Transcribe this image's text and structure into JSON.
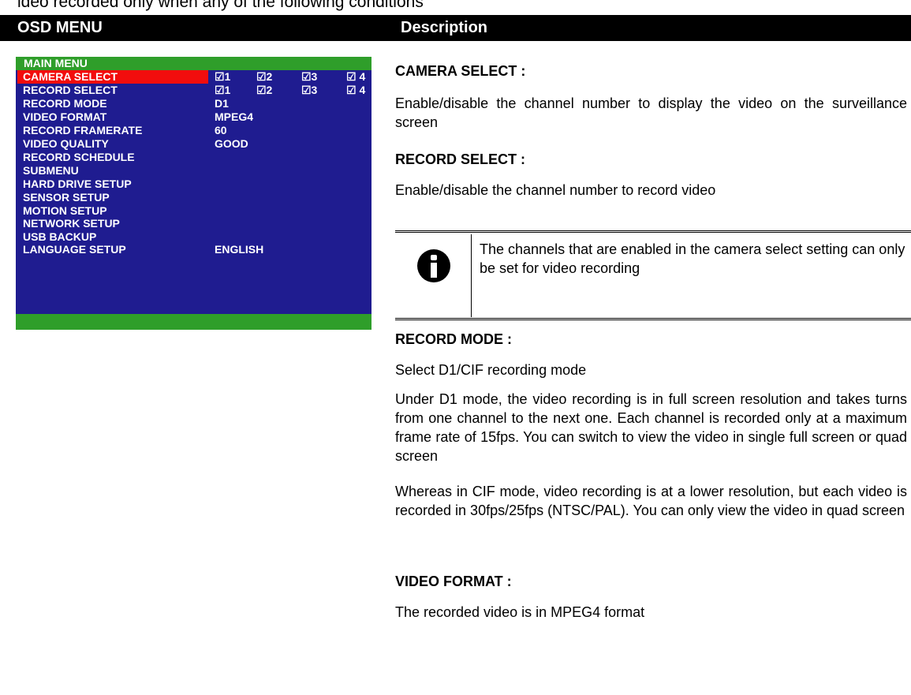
{
  "clipped_line": "ideo recorded only when any of the following conditions",
  "header": {
    "osd_menu": "OSD MENU",
    "description": "Description"
  },
  "osd": {
    "title": "MAIN  MENU",
    "rows": [
      {
        "label": "CAMERA  SELECT",
        "checks": [
          "☑1",
          "☑2",
          "☑3",
          "☑ 4"
        ],
        "selected": true
      },
      {
        "label": "RECORD  SELECT",
        "checks": [
          "☑1",
          "☑2",
          "☑3",
          "☑ 4"
        ]
      },
      {
        "label": "RECORD  MODE",
        "value": "D1"
      },
      {
        "label": "VIDEO  FORMAT",
        "value": "MPEG4"
      },
      {
        "label": "RECORD  FRAMERATE",
        "value": "60"
      },
      {
        "label": "VIDEO  QUALITY",
        "value": "GOOD"
      },
      {
        "label": "RECORD SCHEDULE",
        "value": ""
      },
      {
        "label": "SUBMENU",
        "value": ""
      },
      {
        "label": "HARD  DRIVE  SETUP",
        "value": ""
      },
      {
        "label": "SENSOR  SETUP",
        "value": ""
      },
      {
        "label": "MOTION  SETUP",
        "value": ""
      },
      {
        "label": "NETWORK SETUP",
        "value": ""
      },
      {
        "label": "USB BACKUP",
        "value": ""
      },
      {
        "label": "LANGUAGE  SETUP",
        "value": "ENGLISH"
      }
    ],
    "colors": {
      "panel": "#1f1c90",
      "bar": "#2f9e2a",
      "highlight": "#f20d0d"
    }
  },
  "description": {
    "camera_select_head": "CAMERA   SELECT :",
    "camera_select_text": "Enable/disable the channel number to display the video on the surveillance screen",
    "record_select_head": "RECORD   SELECT :",
    "record_select_text": "Enable/disable the channel number to record video",
    "note_text": "The channels that are enabled in the camera select setting can only be set for video recording",
    "record_mode_head": "RECORD   MODE :",
    "record_mode_text1": "Select D1/CIF recording mode",
    "record_mode_text2": "Under D1 mode, the video recording is in full screen resolution and takes turns from one channel to the next one. Each channel is recorded only at a maximum frame rate of 15fps. You can switch to view the video in single full screen or quad screen",
    "record_mode_text3": "Whereas in CIF mode, video recording is at a lower resolution, but each video is recorded in 30fps/25fps (NTSC/PAL). You can only view the video in quad screen",
    "video_format_head": "VIDEO   FORMAT :",
    "video_format_text": "The recorded video is in MPEG4 format"
  }
}
